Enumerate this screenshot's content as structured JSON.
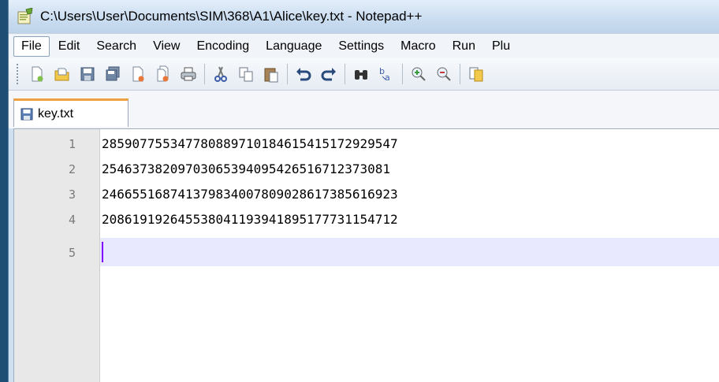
{
  "window": {
    "title": "C:\\Users\\User\\Documents\\SIM\\368\\A1\\Alice\\key.txt - Notepad++"
  },
  "menu": [
    {
      "label": "File",
      "active": true
    },
    {
      "label": "Edit"
    },
    {
      "label": "Search"
    },
    {
      "label": "View"
    },
    {
      "label": "Encoding"
    },
    {
      "label": "Language"
    },
    {
      "label": "Settings"
    },
    {
      "label": "Macro"
    },
    {
      "label": "Run"
    },
    {
      "label": "Plu"
    }
  ],
  "toolbar_icons": [
    "new-file-icon",
    "open-file-icon",
    "save-icon",
    "save-all-icon",
    "close-icon",
    "close-all-icon",
    "print-icon",
    "cut-icon",
    "copy-icon",
    "paste-icon",
    "undo-icon",
    "redo-icon",
    "find-icon",
    "replace-icon",
    "zoom-in-icon",
    "zoom-out-icon",
    "sync-icon"
  ],
  "tab": {
    "label": "key.txt"
  },
  "editor": {
    "lines": [
      {
        "num": "1",
        "text": "28590775534778088971018461541517292954​7"
      },
      {
        "num": "2",
        "text": "254637382097030653940954265167123730​81"
      },
      {
        "num": "3",
        "text": "24665516874137983400780902861738561692​3"
      },
      {
        "num": "4",
        "text": "20861919264553804119394189517773115471​2"
      },
      {
        "num": "5",
        "text": ""
      }
    ]
  },
  "colors": {
    "title_bg": "#c9dcf0",
    "active_tab_accent": "#f0a040",
    "current_line": "#e8e8ff",
    "caret": "#8000ff"
  }
}
